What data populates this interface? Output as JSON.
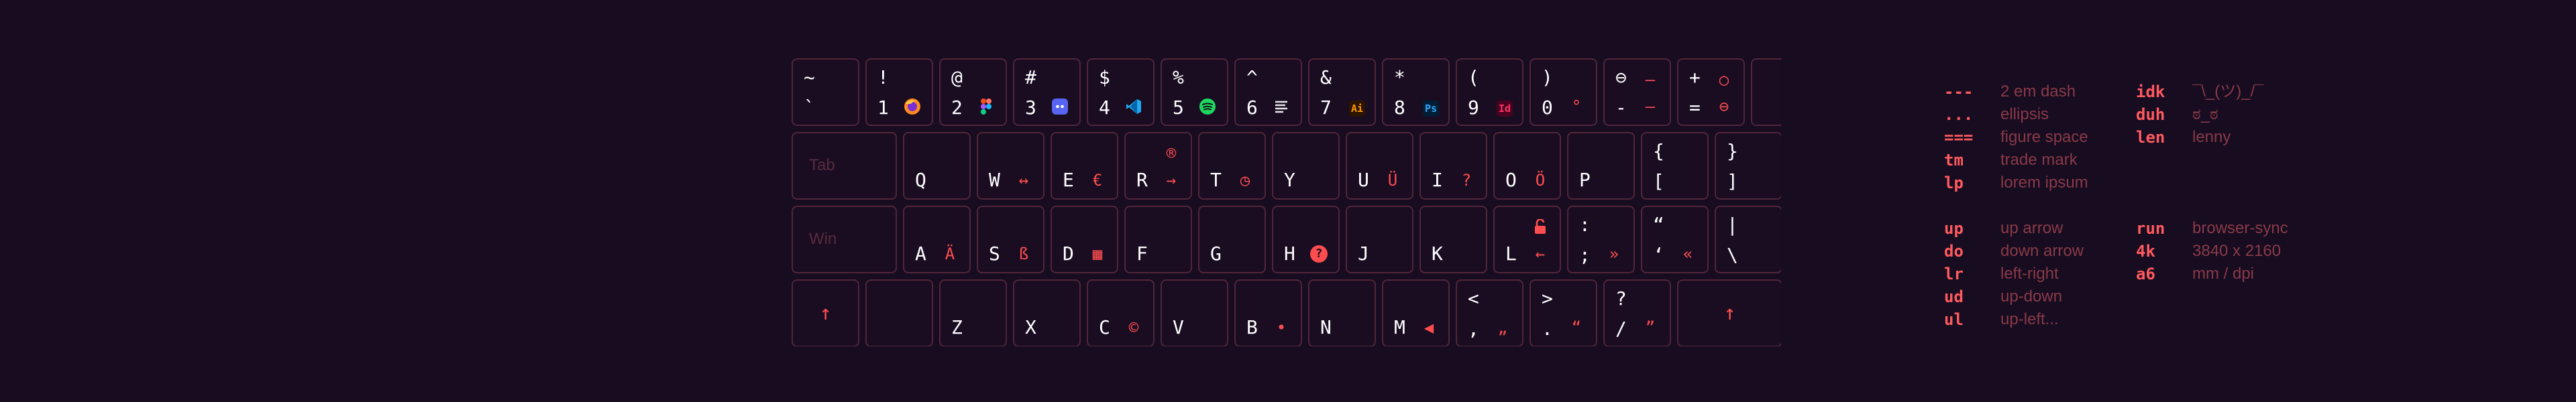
{
  "colors": {
    "background": "#170c20",
    "key_border": "#52253a",
    "accent": "#ff4d4f",
    "muted": "#8a3a48"
  },
  "keyboard": {
    "row1": [
      {
        "top": "~",
        "bottom": "`",
        "icon": ""
      },
      {
        "top": "!",
        "bottom": "1",
        "icon": "firefox-icon"
      },
      {
        "top": "@",
        "bottom": "2",
        "icon": "figma-icon"
      },
      {
        "top": "#",
        "bottom": "3",
        "icon": "discord-icon"
      },
      {
        "top": "$",
        "bottom": "4",
        "icon": "vscode-icon"
      },
      {
        "top": "%",
        "bottom": "5",
        "icon": "spotify-icon"
      },
      {
        "top": "^",
        "bottom": "6",
        "icon": "notes-icon"
      },
      {
        "top": "&",
        "bottom": "7",
        "icon": "illustrator-icon",
        "icon_text": "Ai"
      },
      {
        "top": "*",
        "bottom": "8",
        "icon": "photoshop-icon",
        "icon_text": "Ps"
      },
      {
        "top": "(",
        "bottom": "9",
        "icon": "indesign-icon",
        "icon_text": "Id"
      },
      {
        "top": ")",
        "bottom": "0",
        "icon": "degree-icon",
        "icon_text": "°"
      },
      {
        "top": "⊖",
        "bottom": "-",
        "top_icon_text": "—",
        "icon_text": "–"
      },
      {
        "top": "+",
        "bottom": "=",
        "top_icon_text": "○",
        "icon_text": "⊖"
      }
    ],
    "row2": {
      "tab_label": "Tab",
      "keys": [
        {
          "label": "Q",
          "icon": ""
        },
        {
          "label": "W",
          "icon": "left-right-arrow-icon",
          "icon_text": "↔"
        },
        {
          "label": "E",
          "icon": "euro-icon",
          "icon_text": "€"
        },
        {
          "label": "R",
          "icon": "right-arrow-icon",
          "icon_text": "→",
          "top_icon_text": "®"
        },
        {
          "label": "T",
          "icon": "clock-icon",
          "icon_text": "◷"
        },
        {
          "label": "Y",
          "icon": ""
        },
        {
          "label": "U",
          "icon": "u-umlaut-icon",
          "icon_text": "Ü"
        },
        {
          "label": "I",
          "icon": "question-icon",
          "icon_text": "?"
        },
        {
          "label": "O",
          "icon": "o-umlaut-icon",
          "icon_text": "Ö"
        },
        {
          "label": "P",
          "icon": ""
        },
        {
          "top": "{",
          "bottom": "["
        },
        {
          "top": "}",
          "bottom": "]"
        }
      ]
    },
    "row3": {
      "win_label": "Win",
      "keys": [
        {
          "label": "A",
          "icon": "a-umlaut-icon",
          "icon_text": "Ä"
        },
        {
          "label": "S",
          "icon": "eszett-icon",
          "icon_text": "ß"
        },
        {
          "label": "D",
          "icon": "calendar-icon",
          "icon_text": "▦"
        },
        {
          "label": "F",
          "icon": ""
        },
        {
          "label": "G",
          "icon": ""
        },
        {
          "label": "H",
          "icon": "help-circle-icon",
          "icon_text": "?"
        },
        {
          "label": "J",
          "icon": ""
        },
        {
          "label": "K",
          "icon": ""
        },
        {
          "label": "L",
          "icon": "left-arrow-icon",
          "icon_text": "←",
          "top_icon_text": "🔓"
        },
        {
          "top": ":",
          "bottom": ";",
          "icon_text": "»"
        },
        {
          "top": "“",
          "bottom": "‘",
          "icon_text": "«"
        },
        {
          "top": "|",
          "bottom": "\\"
        }
      ]
    },
    "row4": {
      "left_arrow": "↑",
      "keys": [
        {
          "label": "Z",
          "icon": ""
        },
        {
          "label": "X",
          "icon": ""
        },
        {
          "label": "C",
          "icon": "copyright-icon",
          "icon_text": "©"
        },
        {
          "label": "V",
          "icon": ""
        },
        {
          "label": "B",
          "icon": "bullet-icon",
          "icon_text": "•"
        },
        {
          "label": "N",
          "icon": ""
        },
        {
          "label": "M",
          "icon": "mute-icon",
          "icon_text": "◀"
        },
        {
          "top": "<",
          "bottom": ",",
          "icon_text": "„"
        },
        {
          "top": ">",
          "bottom": ".",
          "icon_text": "“"
        },
        {
          "top": "?",
          "bottom": "/",
          "icon_text": "”"
        }
      ],
      "right_arrow": "↑"
    }
  },
  "legend": {
    "col1": [
      {
        "code": "---",
        "desc": "2 em dash"
      },
      {
        "code": "...",
        "desc": "ellipsis"
      },
      {
        "code": "===",
        "desc": "figure space"
      },
      {
        "code": "tm",
        "desc": "trade mark"
      },
      {
        "code": "lp",
        "desc": "lorem ipsum"
      }
    ],
    "col1b": [
      {
        "code": "up",
        "desc": "up arrow"
      },
      {
        "code": "do",
        "desc": "down arrow"
      },
      {
        "code": "lr",
        "desc": "left-right"
      },
      {
        "code": "ud",
        "desc": "up-down"
      },
      {
        "code": "ul",
        "desc": "up-left..."
      }
    ],
    "col2": [
      {
        "code": "idk",
        "desc": "¯\\_(ツ)_/¯"
      },
      {
        "code": "duh",
        "desc": "ಠ_ಠ"
      },
      {
        "code": "len",
        "desc": "lenny"
      }
    ],
    "col2b": [
      {
        "code": "run",
        "desc": "browser-sync"
      },
      {
        "code": "4k",
        "desc": "3840 x 2160"
      },
      {
        "code": "a6",
        "desc": "mm / dpi"
      }
    ]
  }
}
